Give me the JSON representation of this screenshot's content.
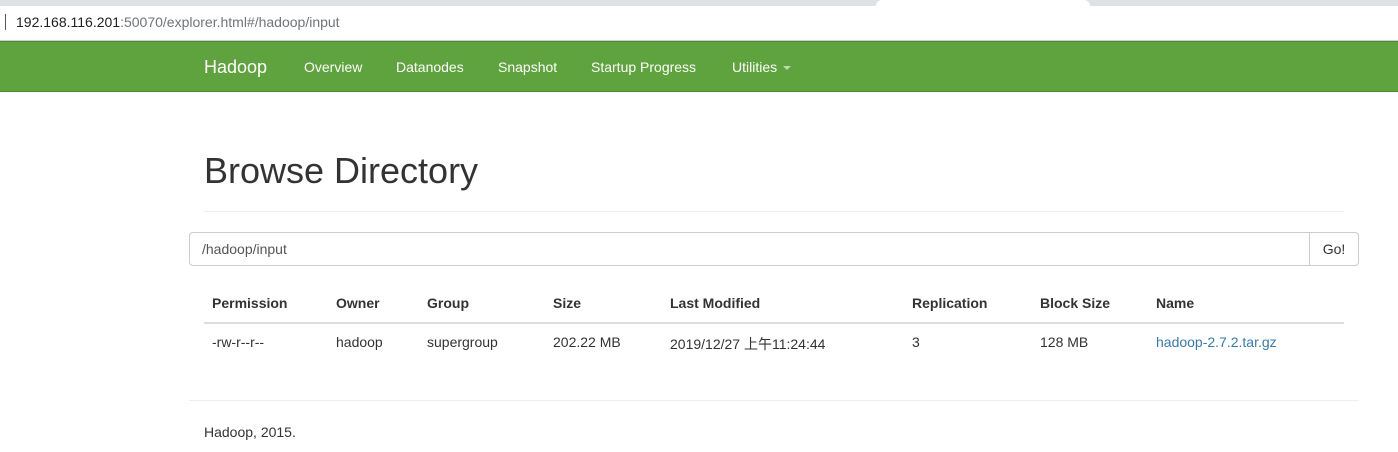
{
  "browser": {
    "url_host": "192.168.116.201",
    "url_rest": ":50070/explorer.html#/hadoop/input"
  },
  "navbar": {
    "brand": "Hadoop",
    "items": [
      "Overview",
      "Datanodes",
      "Snapshot",
      "Startup Progress",
      "Utilities"
    ],
    "background_color": "#5fa33e"
  },
  "page": {
    "title": "Browse Directory"
  },
  "path_bar": {
    "value": "/hadoop/input",
    "go_label": "Go!"
  },
  "table": {
    "headers": [
      "Permission",
      "Owner",
      "Group",
      "Size",
      "Last Modified",
      "Replication",
      "Block Size",
      "Name"
    ],
    "rows": [
      [
        "-rw-r--r--",
        "hadoop",
        "supergroup",
        "202.22 MB",
        "2019/12/27 上午11:24:44",
        "3",
        "128 MB",
        "hadoop-2.7.2.tar.gz"
      ]
    ],
    "link_color": "#337ab7"
  },
  "footer": {
    "text": "Hadoop, 2015."
  }
}
